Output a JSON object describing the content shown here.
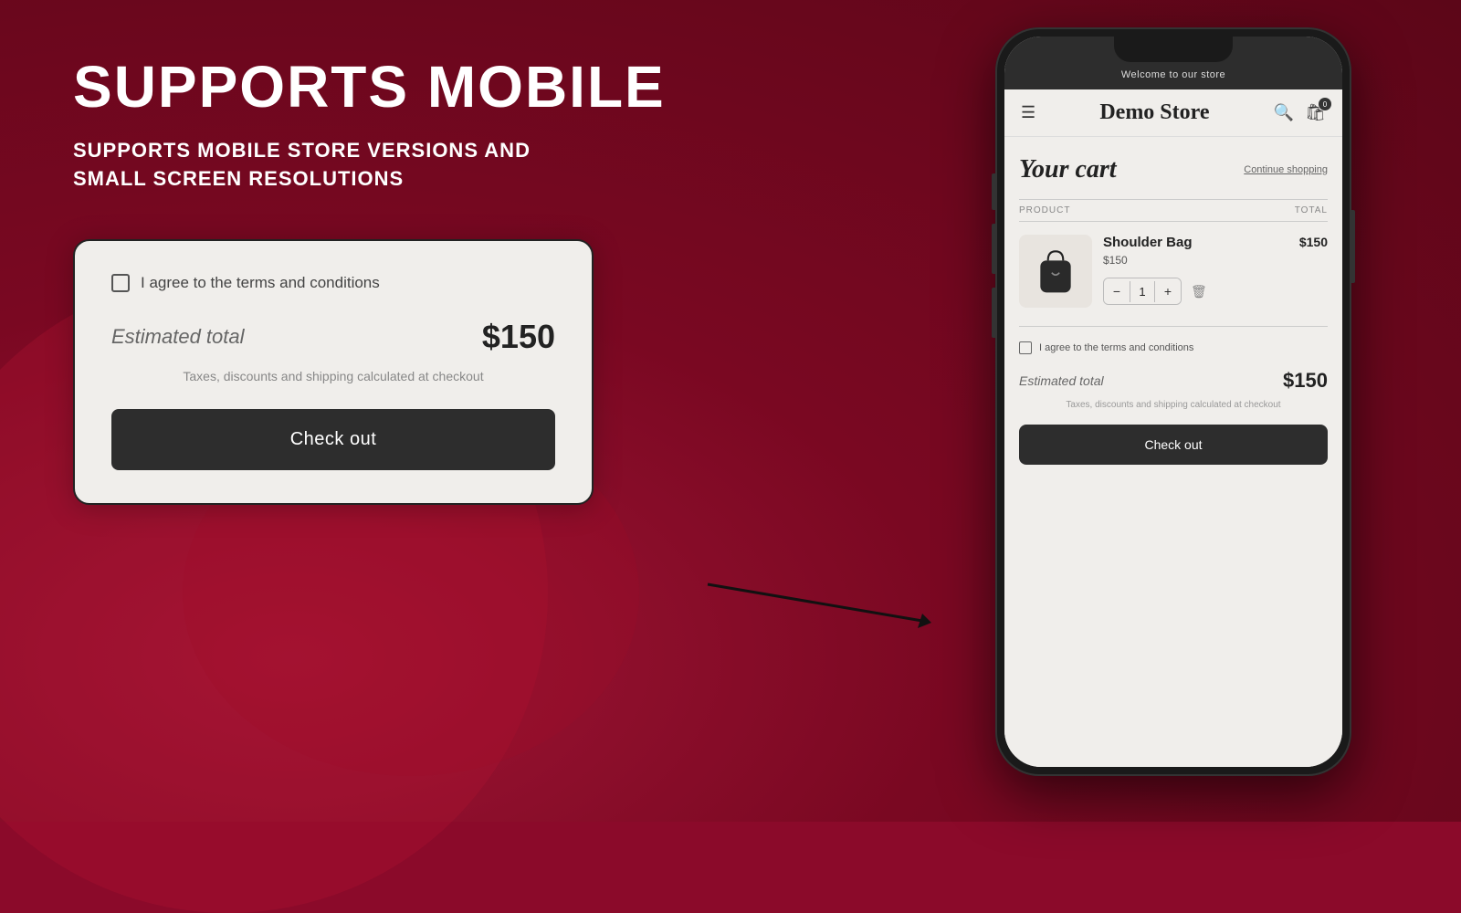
{
  "page": {
    "background_color": "#8B0A2A",
    "accent_color": "#2d2d2d"
  },
  "left": {
    "main_title": "SUPPORTS MOBILE",
    "sub_title": "SUPPORTS MOBILE STORE VERSIONS AND SMALL SCREEN RESOLUTIONS",
    "card": {
      "terms_label": "I agree to the terms and conditions",
      "estimated_label": "Estimated total",
      "total_price": "$150",
      "tax_note": "Taxes, discounts and shipping calculated at checkout",
      "checkout_btn_label": "Check out"
    }
  },
  "phone": {
    "top_bar_text": "Welcome to our store",
    "store_title": "Demo Store",
    "cart_title": "Your cart",
    "continue_shopping": "Continue shopping",
    "col_product": "PRODUCT",
    "col_total": "TOTAL",
    "product": {
      "name": "Shoulder Bag",
      "price": "$150",
      "quantity": "1",
      "total": "$150"
    },
    "checkout_section": {
      "terms_label": "I agree to the terms and conditions",
      "estimated_label": "Estimated total",
      "total_price": "$150",
      "tax_note": "Taxes, discounts and shipping calculated at checkout",
      "checkout_btn_label": "Check out"
    },
    "cart_count": "0"
  }
}
